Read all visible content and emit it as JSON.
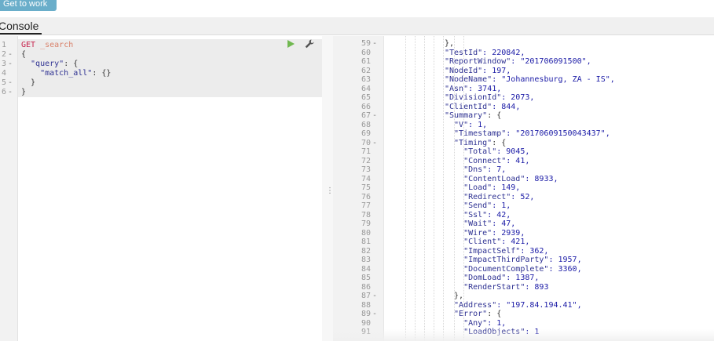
{
  "header": {
    "get_to_work_label": "Get to work"
  },
  "tabs": {
    "console_label": "Console"
  },
  "request": {
    "lines": [
      {
        "num": "1",
        "fold": "",
        "method": "GET",
        "path": "_search"
      },
      {
        "num": "2",
        "fold": "-",
        "text": "{"
      },
      {
        "num": "3",
        "fold": "-",
        "key": "\"query\"",
        "rest": ": {"
      },
      {
        "num": "4",
        "fold": "",
        "key": "\"match_all\"",
        "rest": ": {}"
      },
      {
        "num": "5",
        "fold": "-",
        "text": "}"
      },
      {
        "num": "6",
        "fold": "-",
        "text": "}"
      }
    ]
  },
  "response": {
    "lines": [
      {
        "num": "59",
        "fold": "-",
        "indent": 4,
        "key": "",
        "rest": "},"
      },
      {
        "num": "60",
        "fold": "",
        "indent": 4,
        "key": "\"TestId\"",
        "rest": ": 220842,"
      },
      {
        "num": "61",
        "fold": "",
        "indent": 4,
        "key": "\"ReportWindow\"",
        "rest": ": \"201706091500\","
      },
      {
        "num": "62",
        "fold": "",
        "indent": 4,
        "key": "\"NodeId\"",
        "rest": ": 197,"
      },
      {
        "num": "63",
        "fold": "",
        "indent": 4,
        "key": "\"NodeName\"",
        "rest": ": \"Johannesburg, ZA - IS\","
      },
      {
        "num": "64",
        "fold": "",
        "indent": 4,
        "key": "\"Asn\"",
        "rest": ": 3741,"
      },
      {
        "num": "65",
        "fold": "",
        "indent": 4,
        "key": "\"DivisionId\"",
        "rest": ": 2073,"
      },
      {
        "num": "66",
        "fold": "",
        "indent": 4,
        "key": "\"ClientId\"",
        "rest": ": 844,"
      },
      {
        "num": "67",
        "fold": "-",
        "indent": 4,
        "key": "\"Summary\"",
        "rest": ": {"
      },
      {
        "num": "68",
        "fold": "",
        "indent": 5,
        "key": "\"V\"",
        "rest": ": 1,"
      },
      {
        "num": "69",
        "fold": "",
        "indent": 5,
        "key": "\"Timestamp\"",
        "rest": ": \"20170609150043437\","
      },
      {
        "num": "70",
        "fold": "-",
        "indent": 5,
        "key": "\"Timing\"",
        "rest": ": {"
      },
      {
        "num": "71",
        "fold": "",
        "indent": 6,
        "key": "\"Total\"",
        "rest": ": 9045,"
      },
      {
        "num": "72",
        "fold": "",
        "indent": 6,
        "key": "\"Connect\"",
        "rest": ": 41,"
      },
      {
        "num": "73",
        "fold": "",
        "indent": 6,
        "key": "\"Dns\"",
        "rest": ": 7,"
      },
      {
        "num": "74",
        "fold": "",
        "indent": 6,
        "key": "\"ContentLoad\"",
        "rest": ": 8933,"
      },
      {
        "num": "75",
        "fold": "",
        "indent": 6,
        "key": "\"Load\"",
        "rest": ": 149,"
      },
      {
        "num": "76",
        "fold": "",
        "indent": 6,
        "key": "\"Redirect\"",
        "rest": ": 52,"
      },
      {
        "num": "77",
        "fold": "",
        "indent": 6,
        "key": "\"Send\"",
        "rest": ": 1,"
      },
      {
        "num": "78",
        "fold": "",
        "indent": 6,
        "key": "\"Ssl\"",
        "rest": ": 42,"
      },
      {
        "num": "79",
        "fold": "",
        "indent": 6,
        "key": "\"Wait\"",
        "rest": ": 47,"
      },
      {
        "num": "80",
        "fold": "",
        "indent": 6,
        "key": "\"Wire\"",
        "rest": ": 2939,"
      },
      {
        "num": "81",
        "fold": "",
        "indent": 6,
        "key": "\"Client\"",
        "rest": ": 421,"
      },
      {
        "num": "82",
        "fold": "",
        "indent": 6,
        "key": "\"ImpactSelf\"",
        "rest": ": 362,"
      },
      {
        "num": "83",
        "fold": "",
        "indent": 6,
        "key": "\"ImpactThirdParty\"",
        "rest": ": 1957,"
      },
      {
        "num": "84",
        "fold": "",
        "indent": 6,
        "key": "\"DocumentComplete\"",
        "rest": ": 3360,"
      },
      {
        "num": "85",
        "fold": "",
        "indent": 6,
        "key": "\"DomLoad\"",
        "rest": ": 1387,"
      },
      {
        "num": "86",
        "fold": "",
        "indent": 6,
        "key": "\"RenderStart\"",
        "rest": ": 893"
      },
      {
        "num": "87",
        "fold": "-",
        "indent": 5,
        "key": "",
        "rest": "},"
      },
      {
        "num": "88",
        "fold": "",
        "indent": 5,
        "key": "\"Address\"",
        "rest": ": \"197.84.194.41\","
      },
      {
        "num": "89",
        "fold": "-",
        "indent": 5,
        "key": "\"Error\"",
        "rest": ": {"
      },
      {
        "num": "90",
        "fold": "",
        "indent": 6,
        "key": "\"Any\"",
        "rest": ": 1,"
      },
      {
        "num": "91",
        "fold": "",
        "indent": 6,
        "key": "\"LoadObjects\"",
        "rest": ": 1"
      }
    ]
  },
  "colors": {
    "accent": "#6aaeca",
    "run": "#70b850",
    "method": "#c7254e",
    "key": "#2e3192"
  }
}
